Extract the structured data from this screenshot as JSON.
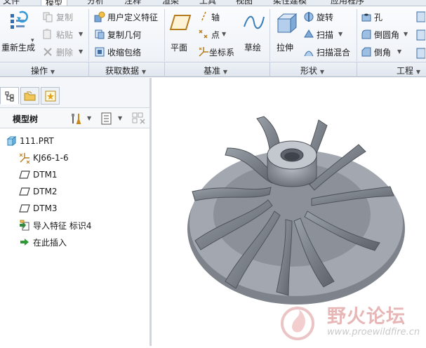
{
  "tabs": [
    "文件",
    "模型",
    "分析",
    "注释",
    "渲染",
    "工具",
    "视图",
    "柔性建模",
    "应用程序"
  ],
  "ribbon": {
    "regenerate": "重新生成",
    "copy": "复制",
    "paste": "粘贴",
    "delete": "删除",
    "user_defined_feature": "用户定义特征",
    "copy_geometry": "复制几何",
    "shrinkwrap": "收缩包络",
    "plane": "平面",
    "axis": "轴",
    "point": "点",
    "coordinate_system": "坐标系",
    "sketch": "草绘",
    "extrude": "拉伸",
    "revolve": "旋转",
    "sweep": "扫描",
    "swept_blend": "扫描混合",
    "hole": "孔",
    "round": "倒圆角",
    "chamfer": "倒角"
  },
  "groups": [
    "操作",
    "获取数据",
    "基准",
    "形状",
    "工程"
  ],
  "panel": {
    "tree_title": "模型树"
  },
  "tree": [
    {
      "label": "111.PRT",
      "icon": "part-icon"
    },
    {
      "label": "KJ66-1-6",
      "icon": "csys-icon"
    },
    {
      "label": "DTM1",
      "icon": "datum-plane-icon"
    },
    {
      "label": "DTM2",
      "icon": "datum-plane-icon"
    },
    {
      "label": "DTM3",
      "icon": "datum-plane-icon"
    },
    {
      "label": "导入特征 标识4",
      "icon": "import-feature-icon"
    },
    {
      "label": "在此插入",
      "icon": "insert-here-icon"
    }
  ],
  "watermark": {
    "brand": "野火论坛",
    "url": "www.proewildfire.cn"
  }
}
